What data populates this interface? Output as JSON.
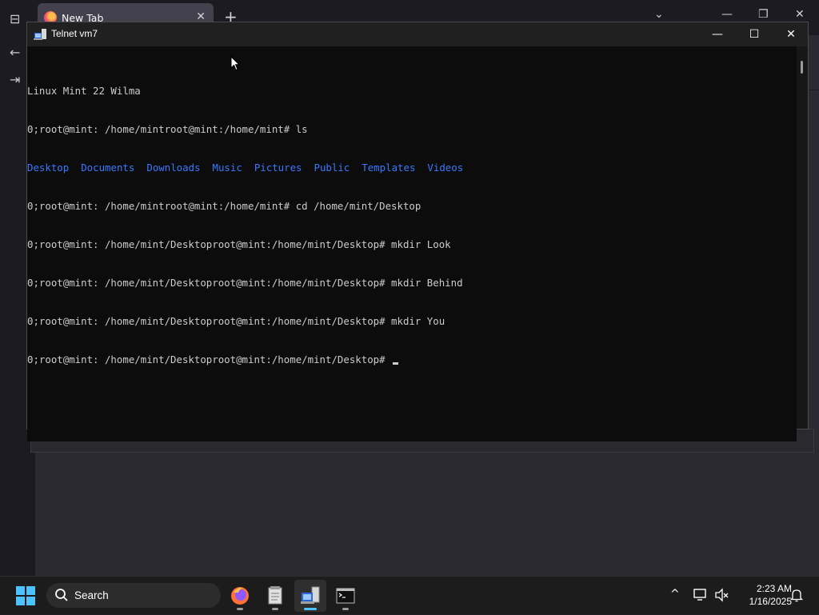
{
  "browser": {
    "tab_title": "New Tab",
    "tab_close": "✕",
    "new_tab": "+",
    "list_all_tabs": "⌄",
    "minimize": "—",
    "restore": "❐",
    "close": "✕"
  },
  "telnet": {
    "title": "Telnet vm7",
    "minimize": "—",
    "maximize": "☐",
    "close": "✕",
    "lines": [
      "Linux Mint 22 Wilma",
      "0;root@mint: /home/mintroot@mint:/home/mint# ls",
      "",
      "0;root@mint: /home/mintroot@mint:/home/mint# cd /home/mint/Desktop",
      "0;root@mint: /home/mint/Desktoproot@mint:/home/mint/Desktop# mkdir Look",
      "0;root@mint: /home/mint/Desktoproot@mint:/home/mint/Desktop# mkdir Behind",
      "0;root@mint: /home/mint/Desktoproot@mint:/home/mint/Desktop# mkdir You",
      "0;root@mint: /home/mint/Desktoproot@mint:/home/mint/Desktop# "
    ],
    "ls_output": [
      "Desktop",
      "Documents",
      "Downloads",
      "Music",
      "Pictures",
      "Public",
      "Templates",
      "Videos"
    ],
    "ls_color": "#3b78ff"
  },
  "taskbar": {
    "search_label": "Search",
    "apps": [
      "firefox-icon",
      "notepad-icon",
      "telnet-icon",
      "terminal-icon"
    ],
    "time": "2:23 AM",
    "date": "1/16/2025",
    "accent": "#4cc2ff"
  }
}
